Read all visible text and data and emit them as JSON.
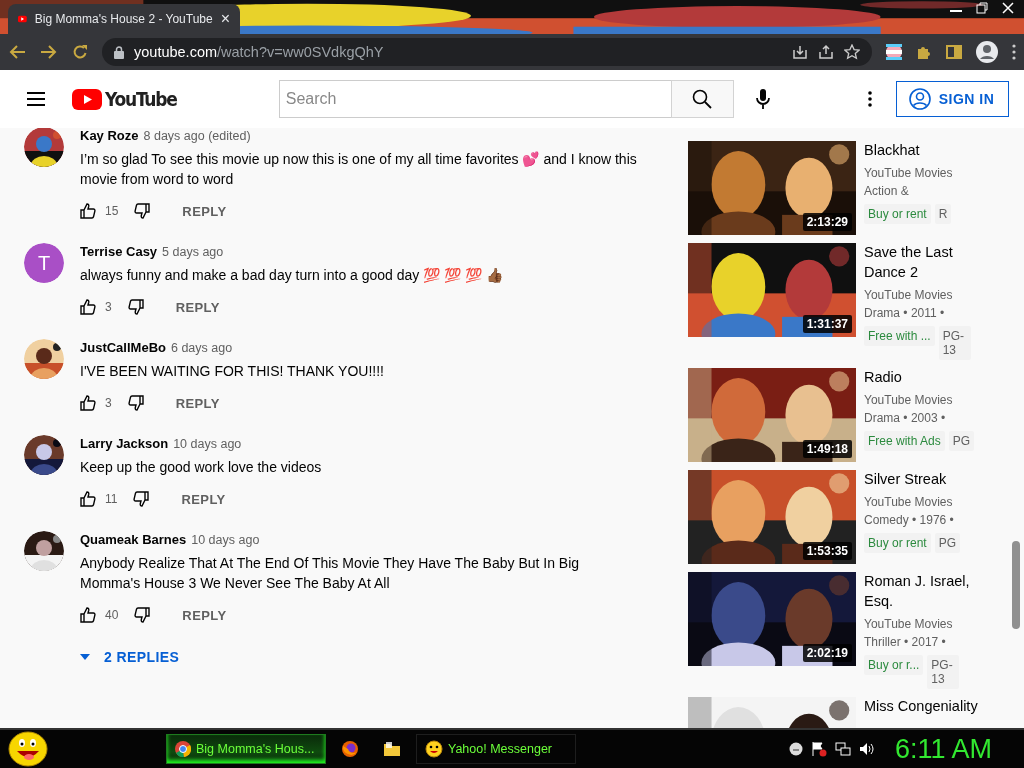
{
  "browser": {
    "tab_title": "Big Momma's House 2 - YouTube",
    "tab_close": "×",
    "url_host": "youtube.com",
    "url_path": "/watch?v=ww0SVdkgQhY"
  },
  "header": {
    "logo_text": "YouTube",
    "search": {
      "placeholder": "Search"
    },
    "sign_in": "SIGN IN"
  },
  "comments": [
    {
      "author": "Kay Roze",
      "time": "8 days ago (edited)",
      "text": "I’m so glad To see this movie up now this is one of my all time favorites 💕  and I know this movie from word to  word",
      "likes": "15",
      "reply": "REPLY"
    },
    {
      "author": "Terrise Casy",
      "time": "5 days ago",
      "text": "always funny and make a bad day turn into a good day 💯 💯 💯 👍🏾",
      "likes": "3",
      "reply": "REPLY",
      "avatar": {
        "kind": "letter",
        "letter": "T",
        "color": "#a94fc6"
      }
    },
    {
      "author": "JustCallMeBo",
      "time": "6 days ago",
      "text": "I'VE BEEN WAITING FOR THIS! THANK YOU!!!!",
      "likes": "3",
      "reply": "REPLY"
    },
    {
      "author": "Larry Jackson",
      "time": "10 days ago",
      "text": "Keep up the good work love the videos",
      "likes": "11",
      "reply": "REPLY"
    },
    {
      "author": "Quameak Barnes",
      "time": "10 days ago",
      "text": "Anybody Realize That At The End Of This Movie They Have The Baby But In Big Momma's House 3 We Never See The Baby At All",
      "likes": "40",
      "reply": "REPLY"
    }
  ],
  "replies_toggle": {
    "label": "2 REPLIES",
    "expanded": false
  },
  "sidebar": [
    {
      "title": "Blackhat",
      "channel": "YouTube Movies",
      "meta": "Action &",
      "duration": "2:13:29",
      "badges": [
        {
          "label": "Buy or rent",
          "kind": "offer"
        },
        {
          "label": "R",
          "kind": "rating"
        }
      ]
    },
    {
      "title": "Save the Last Dance 2",
      "channel": "YouTube Movies",
      "meta": "Drama • 2011 •",
      "duration": "1:31:37",
      "badges": [
        {
          "label": "Free with ...",
          "kind": "offer"
        },
        {
          "label": "PG-13",
          "kind": "rating"
        }
      ]
    },
    {
      "title": "Radio",
      "channel": "YouTube Movies",
      "meta": "Drama • 2003 •",
      "duration": "1:49:18",
      "badges": [
        {
          "label": "Free with Ads",
          "kind": "offer"
        },
        {
          "label": "PG",
          "kind": "rating"
        }
      ]
    },
    {
      "title": "Silver Streak",
      "channel": "YouTube Movies",
      "meta": "Comedy • 1976 •",
      "duration": "1:53:35",
      "badges": [
        {
          "label": "Buy or rent",
          "kind": "offer"
        },
        {
          "label": "PG",
          "kind": "rating"
        }
      ]
    },
    {
      "title": "Roman J. Israel, Esq.",
      "channel": "YouTube Movies",
      "meta": "Thriller • 2017 •",
      "duration": "2:02:19",
      "badges": [
        {
          "label": "Buy or r...",
          "kind": "offer"
        },
        {
          "label": "PG-13",
          "kind": "rating"
        }
      ]
    },
    {
      "title": "Miss Congeniality"
    }
  ],
  "taskbar": {
    "tasks": [
      {
        "kind": "chrome",
        "label": "Big Momma's Hous...",
        "selected": true
      },
      {
        "kind": "firefox",
        "selected": false
      },
      {
        "kind": "folder",
        "selected": false
      },
      {
        "kind": "yahoo",
        "label": "Yahoo! Messenger",
        "selected": false
      }
    ],
    "clock": "6:11 AM"
  }
}
